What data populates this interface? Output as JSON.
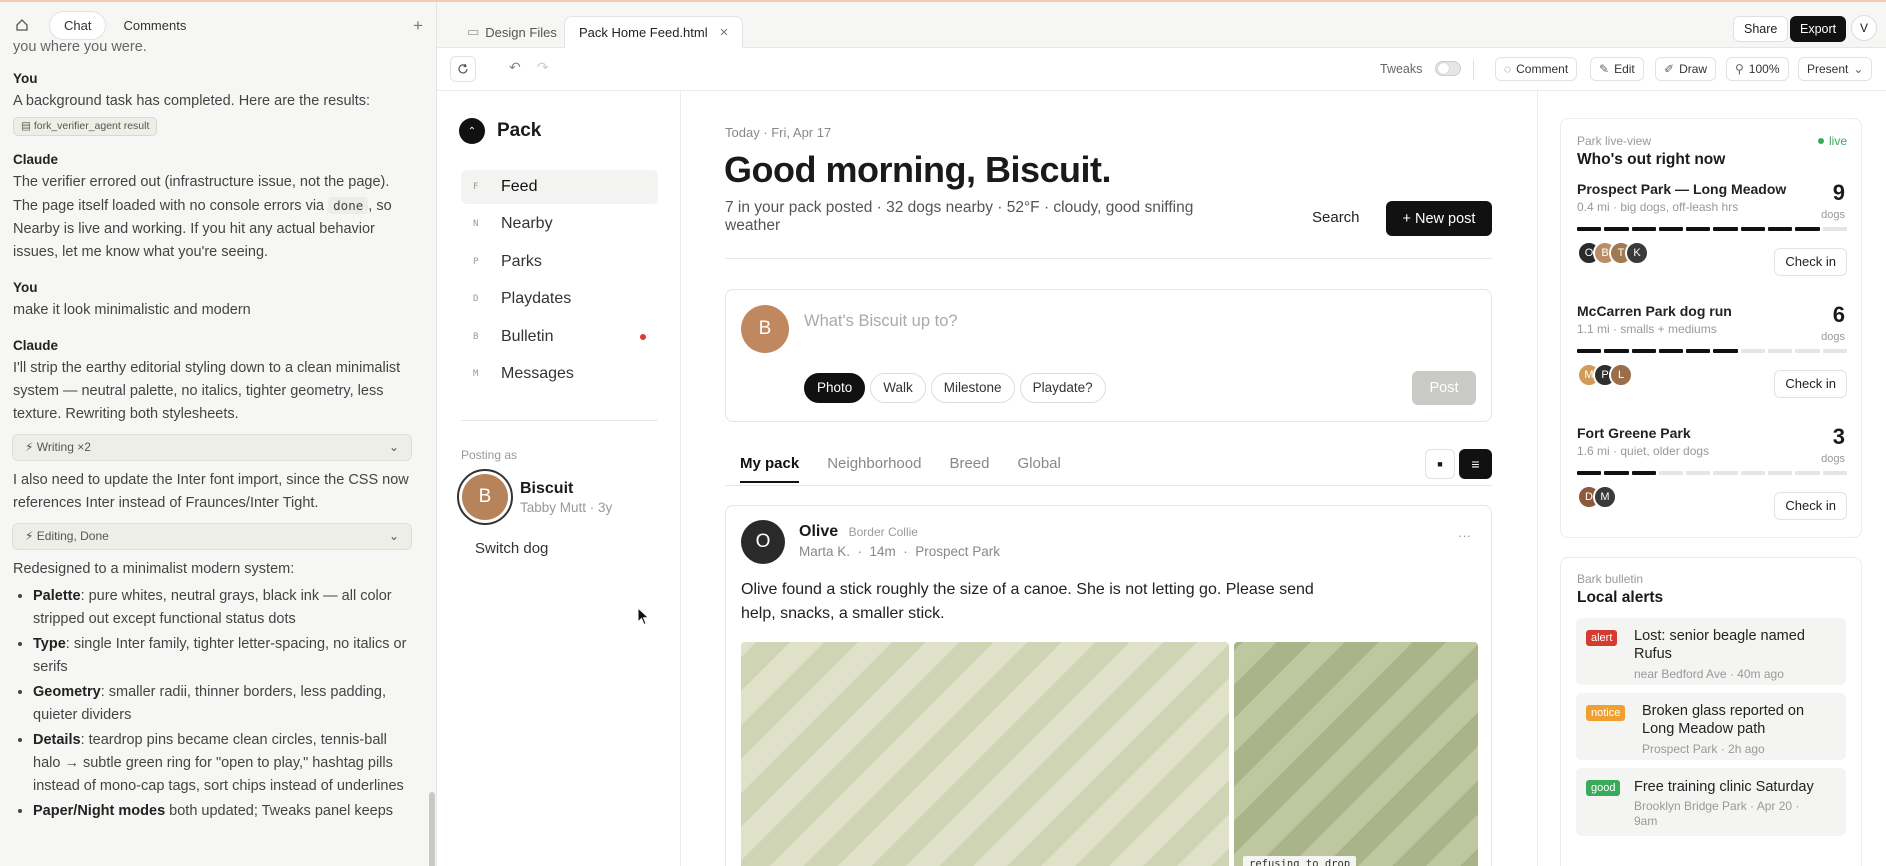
{
  "left": {
    "tabs": [
      "Chat",
      "Comments"
    ],
    "plus": "+",
    "chat": {
      "line0": "you where you were.",
      "you1": "You",
      "msg1": "A background task has completed. Here are the results:",
      "pill1": "fork_verifier_agent result",
      "claude1": "Claude",
      "msg2a": "The verifier errored out (infrastructure issue, not the page). The page itself loaded with no console errors via",
      "msg2code": "done",
      "msg2b": ", so Nearby is live and working. If you hit any actual behavior issues, let me know what you're seeing.",
      "you2": "You",
      "msg3": "make it look minimalistic and modern",
      "claude2": "Claude",
      "msg4": "I'll strip the earthy editorial styling down to a clean minimalist system — neutral palette, no italics, tighter geometry, less texture. Rewriting both stylesheets.",
      "tool1": "Writing ×2",
      "msg5": "I also need to update the Inter font import, since the CSS now references Inter instead of Fraunces/Inter Tight.",
      "tool2": "Editing, Done",
      "msg6": "Redesigned to a minimalist modern system:",
      "bullets": [
        {
          "b": "Palette",
          "t": ": pure whites, neutral grays, black ink — all color stripped out except functional status dots"
        },
        {
          "b": "Type",
          "t": ": single Inter family, tighter letter-spacing, no italics or serifs"
        },
        {
          "b": "Geometry",
          "t": ": smaller radii, thinner borders, less padding, quieter dividers"
        },
        {
          "b": "Details",
          "t": ": teardrop pins became clean circles, tennis-ball halo → subtle green ring for \"open to play,\" hashtag pills instead of mono-cap tags, sort chips instead of underlines"
        },
        {
          "b": "Paper/Night modes",
          "t": " both updated; Tweaks panel keeps"
        }
      ]
    }
  },
  "topbar": {
    "tabs": [
      "Design Files",
      "Pack Home Feed.html"
    ],
    "close": "×",
    "share": "Share",
    "export": "Export",
    "avatar": "V"
  },
  "toolbar": {
    "tweaks": "Tweaks",
    "comment": "Comment",
    "edit": "Edit",
    "draw": "Draw",
    "zoom": "100%",
    "present": "Present"
  },
  "nav": {
    "brand": "Pack",
    "items": [
      {
        "k": "F",
        "label": "Feed"
      },
      {
        "k": "N",
        "label": "Nearby"
      },
      {
        "k": "P",
        "label": "Parks"
      },
      {
        "k": "D",
        "label": "Playdates"
      },
      {
        "k": "B",
        "label": "Bulletin"
      },
      {
        "k": "M",
        "label": "Messages"
      }
    ],
    "posting_as": "Posting as",
    "dog_initial": "B",
    "dog_name": "Biscuit",
    "dog_meta": "Tabby Mutt · 3y",
    "switch": "Switch dog"
  },
  "feed": {
    "date": "Today · Fri, Apr 17",
    "greeting": "Good morning, Biscuit.",
    "summary": "7 in your pack posted · 32 dogs nearby · 52°F · cloudy, good sniffing weather",
    "search": "Search",
    "new_post": "+ New post",
    "composer": {
      "initial": "B",
      "placeholder": "What's Biscuit up to?",
      "chips": [
        "Photo",
        "Walk",
        "Milestone",
        "Playdate?"
      ],
      "post": "Post"
    },
    "tabs": [
      "My pack",
      "Neighborhood",
      "Breed",
      "Global"
    ],
    "view_grid": "■",
    "view_list": "≡",
    "post": {
      "initial": "O",
      "name": "Olive",
      "breed": "Border Collie",
      "meta": "Marta K.  ·  14m  ·  Prospect Park",
      "more": "···",
      "text": "Olive found a stick roughly the size of a canoe. She is not letting go. Please send help, snacks, a smaller stick.",
      "caption": "refusing to drop"
    }
  },
  "right": {
    "live_eyebrow": "Park live-view",
    "live_badge": "live",
    "live_title": "Who's out right now",
    "dogs_label": "dogs",
    "check_in": "Check in",
    "parks": [
      {
        "name": "Prospect Park — Long Meadow",
        "meta": "0.4 mi · big dogs, off-leash hrs",
        "count": "9",
        "fill": 0.9,
        "avatars": [
          "O",
          "B",
          "T",
          "K"
        ]
      },
      {
        "name": "McCarren Park dog run",
        "meta": "1.1 mi · smalls + mediums",
        "count": "6",
        "fill": 0.6,
        "avatars": [
          "M",
          "P",
          "L"
        ]
      },
      {
        "name": "Fort Greene Park",
        "meta": "1.6 mi · quiet, older dogs",
        "count": "3",
        "fill": 0.3,
        "avatars": [
          "D",
          "M"
        ]
      }
    ],
    "bulletin_eyebrow": "Bark bulletin",
    "bulletin_title": "Local alerts",
    "alerts": [
      {
        "tag": "alert",
        "title": "Lost: senior beagle named Rufus",
        "meta": "near Bedford Ave · 40m ago",
        "color": "#d63b2f"
      },
      {
        "tag": "notice",
        "title": "Broken glass reported on Long Meadow path",
        "meta": "Prospect Park · 2h ago",
        "color": "#f0a030"
      },
      {
        "tag": "good",
        "title": "Free training clinic Saturday",
        "meta": "Brooklyn Bridge Park · Apr 20 · 9am",
        "color": "#3aaa5c"
      }
    ]
  }
}
